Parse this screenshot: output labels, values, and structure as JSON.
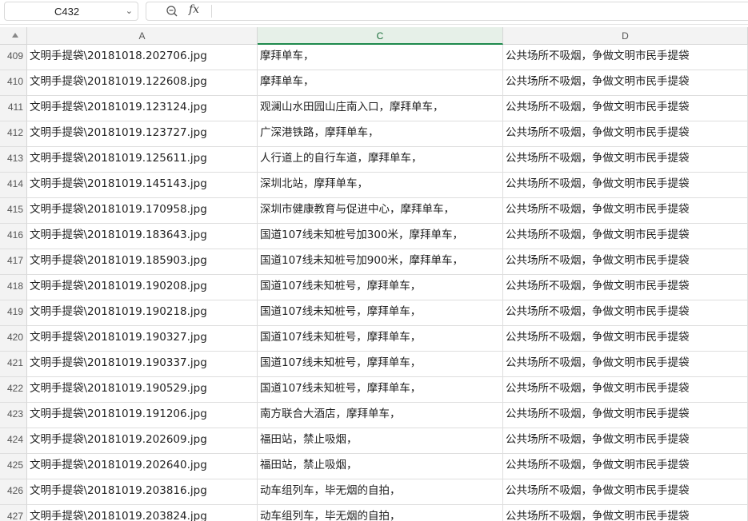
{
  "formula_bar": {
    "cell_reference": "C432",
    "dropdown_icon": "chevron-down-icon",
    "zoom_icon": "zoom-icon",
    "function_icon_label": "fx",
    "formula_value": ""
  },
  "grid": {
    "columns": [
      {
        "label": "A",
        "selected": false
      },
      {
        "label": "C",
        "selected": true
      },
      {
        "label": "D",
        "selected": false
      }
    ],
    "selected_column_color": "#1e8a4c",
    "rows": [
      {
        "num": "409",
        "a": "文明手提袋\\20181018.202706.jpg",
        "c": "摩拜单车，",
        "d": "公共场所不吸烟，争做文明市民手提袋"
      },
      {
        "num": "410",
        "a": "文明手提袋\\20181019.122608.jpg",
        "c": "摩拜单车，",
        "d": "公共场所不吸烟，争做文明市民手提袋"
      },
      {
        "num": "411",
        "a": "文明手提袋\\20181019.123124.jpg",
        "c": "观澜山水田园山庄南入口，摩拜单车，",
        "d": "公共场所不吸烟，争做文明市民手提袋"
      },
      {
        "num": "412",
        "a": "文明手提袋\\20181019.123727.jpg",
        "c": "广深港铁路，摩拜单车，",
        "d": "公共场所不吸烟，争做文明市民手提袋"
      },
      {
        "num": "413",
        "a": "文明手提袋\\20181019.125611.jpg",
        "c": "人行道上的自行车道，摩拜单车，",
        "d": "公共场所不吸烟，争做文明市民手提袋"
      },
      {
        "num": "414",
        "a": "文明手提袋\\20181019.145143.jpg",
        "c": "深圳北站，摩拜单车，",
        "d": "公共场所不吸烟，争做文明市民手提袋"
      },
      {
        "num": "415",
        "a": "文明手提袋\\20181019.170958.jpg",
        "c": "深圳市健康教育与促进中心，摩拜单车，",
        "d": "公共场所不吸烟，争做文明市民手提袋"
      },
      {
        "num": "416",
        "a": "文明手提袋\\20181019.183643.jpg",
        "c": "国道107线未知桩号加300米，摩拜单车，",
        "d": "公共场所不吸烟，争做文明市民手提袋"
      },
      {
        "num": "417",
        "a": "文明手提袋\\20181019.185903.jpg",
        "c": "国道107线未知桩号加900米，摩拜单车，",
        "d": "公共场所不吸烟，争做文明市民手提袋"
      },
      {
        "num": "418",
        "a": "文明手提袋\\20181019.190208.jpg",
        "c": "国道107线未知桩号，摩拜单车，",
        "d": "公共场所不吸烟，争做文明市民手提袋"
      },
      {
        "num": "419",
        "a": "文明手提袋\\20181019.190218.jpg",
        "c": "国道107线未知桩号，摩拜单车，",
        "d": "公共场所不吸烟，争做文明市民手提袋"
      },
      {
        "num": "420",
        "a": "文明手提袋\\20181019.190327.jpg",
        "c": "国道107线未知桩号，摩拜单车，",
        "d": "公共场所不吸烟，争做文明市民手提袋"
      },
      {
        "num": "421",
        "a": "文明手提袋\\20181019.190337.jpg",
        "c": "国道107线未知桩号，摩拜单车，",
        "d": "公共场所不吸烟，争做文明市民手提袋"
      },
      {
        "num": "422",
        "a": "文明手提袋\\20181019.190529.jpg",
        "c": "国道107线未知桩号，摩拜单车，",
        "d": "公共场所不吸烟，争做文明市民手提袋"
      },
      {
        "num": "423",
        "a": "文明手提袋\\20181019.191206.jpg",
        "c": "南方联合大酒店，摩拜单车，",
        "d": "公共场所不吸烟，争做文明市民手提袋"
      },
      {
        "num": "424",
        "a": "文明手提袋\\20181019.202609.jpg",
        "c": "福田站，禁止吸烟，",
        "d": "公共场所不吸烟，争做文明市民手提袋"
      },
      {
        "num": "425",
        "a": "文明手提袋\\20181019.202640.jpg",
        "c": "福田站，禁止吸烟，",
        "d": "公共场所不吸烟，争做文明市民手提袋"
      },
      {
        "num": "426",
        "a": "文明手提袋\\20181019.203816.jpg",
        "c": "动车组列车，毕无烟的自拍，",
        "d": "公共场所不吸烟，争做文明市民手提袋"
      },
      {
        "num": "427",
        "a": "文明手提袋\\20181019.203824.jpg",
        "c": "动车组列车，毕无烟的自拍，",
        "d": "公共场所不吸烟，争做文明市民手提袋"
      }
    ]
  }
}
